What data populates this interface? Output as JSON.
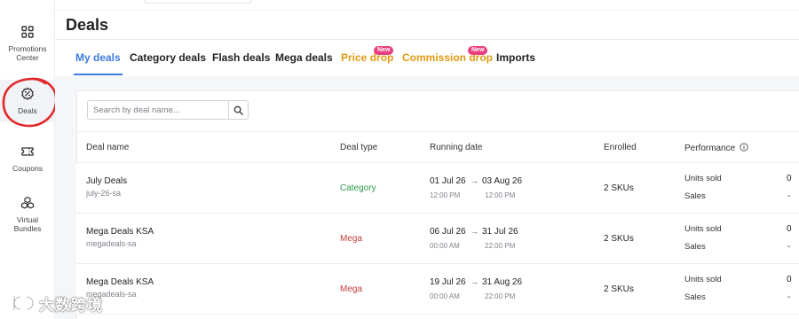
{
  "sidebar": {
    "items": [
      {
        "label_1": "Promotions",
        "label_2": "Center",
        "icon": "grid-icon"
      },
      {
        "label_1": "Deals",
        "label_2": "",
        "icon": "percent-badge-icon",
        "active": true
      },
      {
        "label_1": "Coupons",
        "label_2": "",
        "icon": "ticket-icon"
      },
      {
        "label_1": "Virtual",
        "label_2": "Bundles",
        "icon": "cubes-icon"
      }
    ]
  },
  "header": {
    "title": "Deals"
  },
  "tabs": [
    {
      "label": "My deals",
      "active": true
    },
    {
      "label": "Category deals"
    },
    {
      "label": "Flash deals"
    },
    {
      "label": "Mega deals"
    },
    {
      "label": "Price drop",
      "badge": "New"
    },
    {
      "label": "Commission drop",
      "badge": "New"
    },
    {
      "label": "Imports"
    }
  ],
  "search": {
    "placeholder": "Search by deal name..."
  },
  "table": {
    "headers": {
      "name": "Deal name",
      "type": "Deal type",
      "running": "Running date",
      "enrolled": "Enrolled",
      "performance": "Performance"
    },
    "rows": [
      {
        "name": "July Deals",
        "id": "july-26-sa",
        "type": "Category",
        "start_date": "01 Jul 26",
        "start_time": "12:00 PM",
        "end_date": "03 Aug 26",
        "end_time": "12:00 PM",
        "enrolled": "2 SKUs",
        "units_label": "Units sold",
        "units_value": "0",
        "sales_label": "Sales",
        "sales_value": "-"
      },
      {
        "name": "Mega Deals KSA",
        "id": "megadeals-sa",
        "type": "Mega",
        "start_date": "06 Jul 26",
        "start_time": "00:00 AM",
        "end_date": "31 Jul 26",
        "end_time": "22:00 PM",
        "enrolled": "2 SKUs",
        "units_label": "Units sold",
        "units_value": "0",
        "sales_label": "Sales",
        "sales_value": "-"
      },
      {
        "name": "Mega Deals KSA",
        "id": "megadeals-sa",
        "type": "Mega",
        "start_date": "19 Jul 26",
        "start_time": "00:00 AM",
        "end_date": "31 Aug 26",
        "end_time": "22:00 PM",
        "enrolled": "2 SKUs",
        "units_label": "Units sold",
        "units_value": "0",
        "sales_label": "Sales",
        "sales_value": "-"
      }
    ]
  },
  "watermark": {
    "text": "大数跨境"
  },
  "colors": {
    "accent": "#3d7be0",
    "orange_tab": "#e09a12",
    "badge": "#e83f7f",
    "category_type": "#2e9a4a",
    "mega_type": "#c53b3b",
    "annotation": "#e0282b"
  }
}
